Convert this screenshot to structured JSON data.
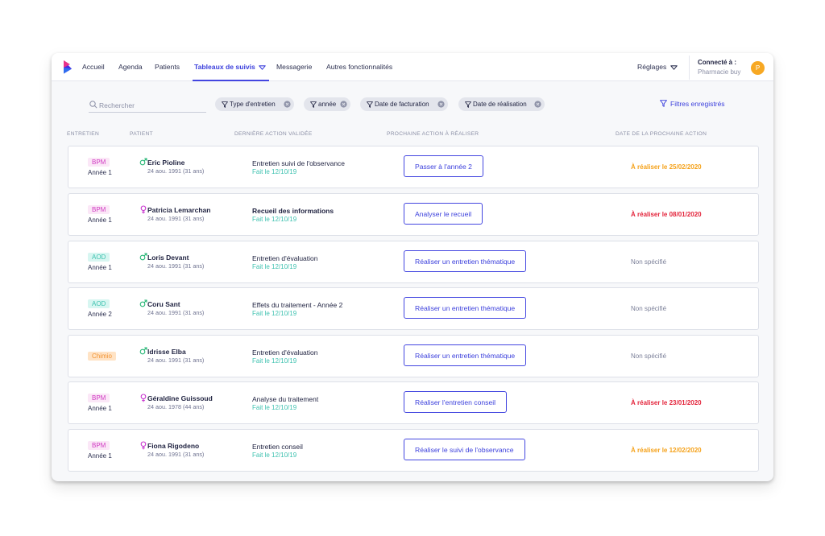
{
  "nav": {
    "items": [
      {
        "label": "Accueil"
      },
      {
        "label": "Agenda"
      },
      {
        "label": "Patients"
      },
      {
        "label": "Tableaux de suivis"
      },
      {
        "label": "Messagerie"
      },
      {
        "label": "Autres fonctionnalités"
      }
    ],
    "active_item": "Tableaux de suivis",
    "settings_label": "Réglages",
    "connected_label": "Connecté à :",
    "connected_value": "Pharmacie buy",
    "avatar_initial": "P"
  },
  "filters": {
    "search_placeholder": "Rechercher",
    "chips": [
      {
        "label": "Type d'entretien"
      },
      {
        "label": "année"
      },
      {
        "label": "Date de facturation"
      },
      {
        "label": "Date de réalisation"
      }
    ],
    "saved_filters_label": "Filtres enregistrés"
  },
  "table": {
    "headers": [
      "ENTRETIEN",
      "PATIENT",
      "DERNIÈRE ACTION VALIDÉE",
      "PROCHAINE ACTION À RÉALISER",
      "DATE DE LA PROCHAINE ACTION"
    ],
    "rows": [
      {
        "type": "BPM",
        "type_style": "bpm",
        "year": "Année 1",
        "sex": "male",
        "patient": "Eric Pioline",
        "birth": "24 aou. 1991 (31 ans)",
        "last_action": "Entretien suivi de l'observance",
        "last_action_bold": false,
        "last_action_date": "Fait le 12/10/19",
        "next_action": "Passer à l'année 2",
        "due": "À réaliser le 25/02/2020",
        "due_style": "orange"
      },
      {
        "type": "BPM",
        "type_style": "bpm",
        "year": "Année 1",
        "sex": "female",
        "patient": "Patricia Lemarchan",
        "birth": "24 aou. 1991 (31 ans)",
        "last_action": "Recueil des informations",
        "last_action_bold": true,
        "last_action_date": "Fait le 12/10/19",
        "next_action": "Analyser le recueil",
        "due": "À réaliser le 08/01/2020",
        "due_style": "red"
      },
      {
        "type": "AOD",
        "type_style": "aod",
        "year": "Année 1",
        "sex": "male",
        "patient": "Loris Devant",
        "birth": "24 aou. 1991 (31 ans)",
        "last_action": "Entretien d'évaluation",
        "last_action_bold": false,
        "last_action_date": "Fait le 12/10/19",
        "next_action": "Réaliser un entretien thématique",
        "due": "Non spécifié",
        "due_style": "grey"
      },
      {
        "type": "AOD",
        "type_style": "aod",
        "year": "Année 2",
        "sex": "male",
        "patient": "Coru Sant",
        "birth": "24 aou. 1991 (31 ans)",
        "last_action": "Effets du traitement - Année 2",
        "last_action_bold": false,
        "last_action_date": "Fait le 12/10/19",
        "next_action": "Réaliser un entretien thématique",
        "due": "Non spécifié",
        "due_style": "grey"
      },
      {
        "type": "Chimio",
        "type_style": "chimio",
        "year": "",
        "sex": "male",
        "patient": "Idrisse Elba",
        "birth": "24 aou. 1991 (31 ans)",
        "last_action": "Entretien d'évaluation",
        "last_action_bold": false,
        "last_action_date": "Fait le 12/10/19",
        "next_action": "Réaliser un entretien thématique",
        "due": "Non spécifié",
        "due_style": "grey"
      },
      {
        "type": "BPM",
        "type_style": "bpm",
        "year": "Année 1",
        "sex": "female",
        "patient": "Géraldine Guissoud",
        "birth": "24 aou. 1978 (44 ans)",
        "last_action": "Analyse du traitement",
        "last_action_bold": false,
        "last_action_date": "Fait le 12/10/19",
        "next_action": "Réaliser l'entretien conseil",
        "due": "À réaliser le 23/01/2020",
        "due_style": "red"
      },
      {
        "type": "BPM",
        "type_style": "bpm",
        "year": "Année 1",
        "sex": "female",
        "patient": "Fiona Rigodeno",
        "birth": "24 aou. 1991 (31 ans)",
        "last_action": "Entretien conseil",
        "last_action_bold": false,
        "last_action_date": "Fait le 12/10/19",
        "next_action": "Réaliser le suivi de l'observance",
        "due": "À réaliser le 12/02/2020",
        "due_style": "orange"
      }
    ]
  },
  "colors": {
    "accent": "#4346e0",
    "bpm_text": "#d03ac2",
    "aod_text": "#3fc2b0",
    "chimio_text": "#f19434",
    "due_orange": "#f5a21b",
    "due_red": "#e3243b",
    "male_icon": "#22b573",
    "female_icon": "#c93ad0",
    "avatar": "#f7a823"
  },
  "icons": {
    "logo": "app-logo",
    "filter": "filter-funnel-icon",
    "clear": "clear-circle-x-icon",
    "search": "search-icon",
    "chevron": "chevron-down-icon",
    "male": "male-icon",
    "female": "female-icon"
  }
}
